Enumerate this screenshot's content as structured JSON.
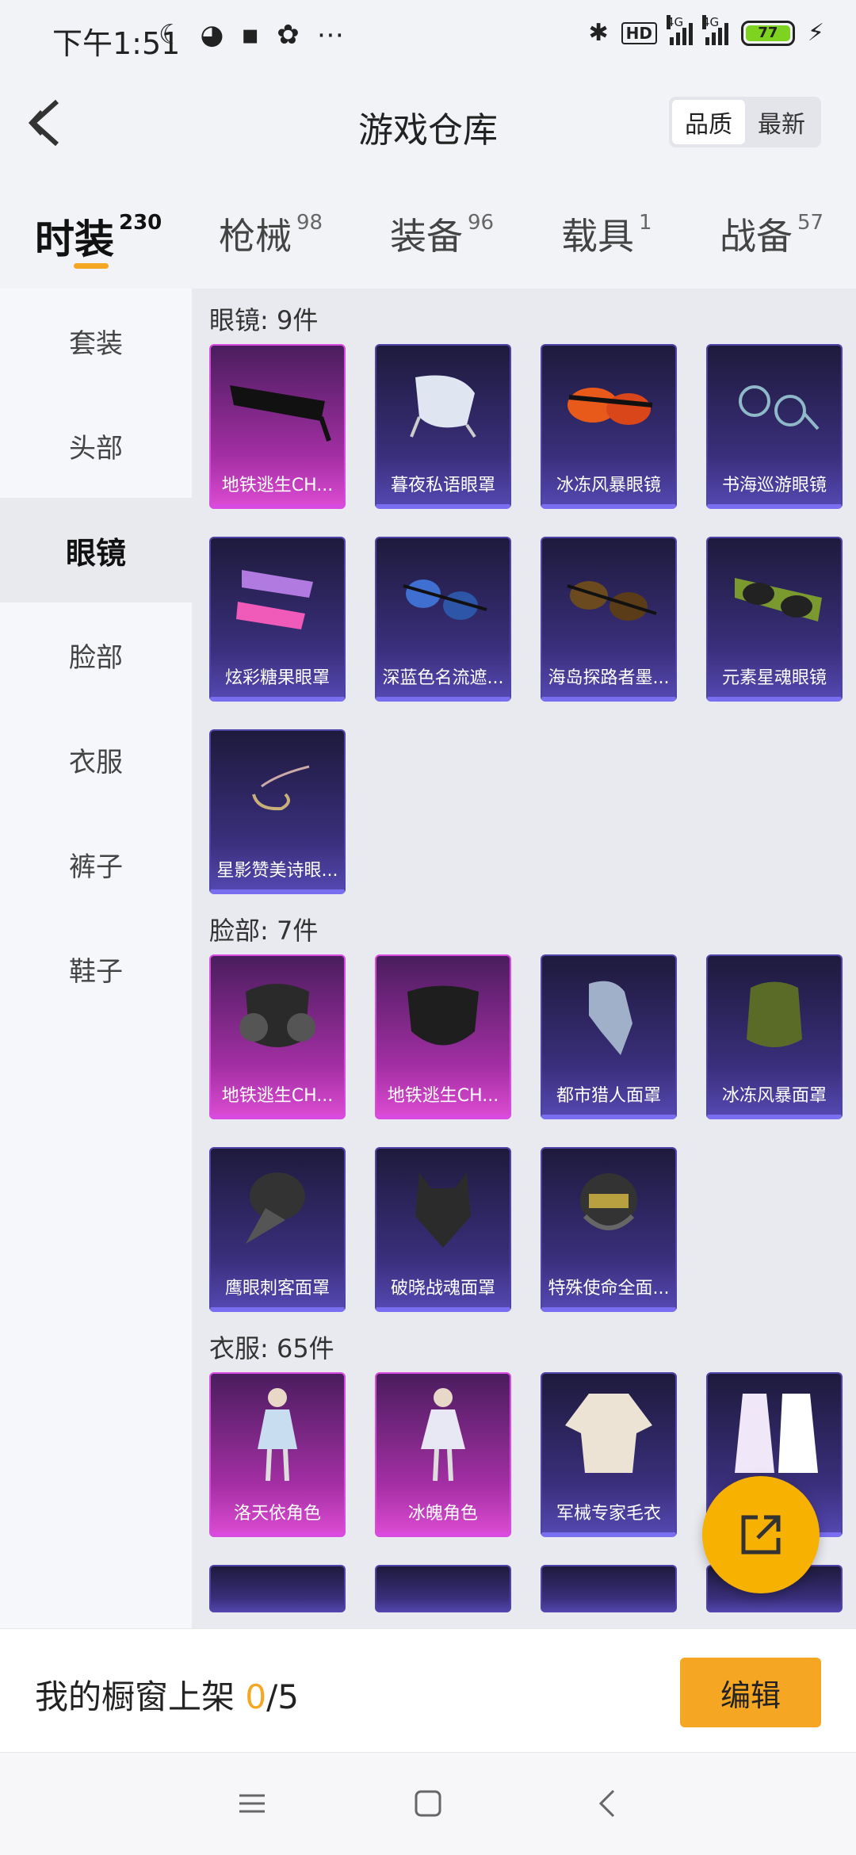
{
  "status": {
    "time": "下午1:51",
    "battery": "77",
    "net1": "4G",
    "net2": "4G",
    "hd": "HD"
  },
  "header": {
    "title": "游戏仓库",
    "toggle": [
      "品质",
      "最新"
    ],
    "toggle_active": 0
  },
  "tabs": [
    {
      "label": "时装",
      "count": "230",
      "active": true
    },
    {
      "label": "枪械",
      "count": "98"
    },
    {
      "label": "装备",
      "count": "96"
    },
    {
      "label": "载具",
      "count": "1"
    },
    {
      "label": "战备",
      "count": "57"
    }
  ],
  "sidebar": [
    {
      "label": "套装"
    },
    {
      "label": "头部"
    },
    {
      "label": "眼镜",
      "active": true
    },
    {
      "label": "脸部"
    },
    {
      "label": "衣服"
    },
    {
      "label": "裤子"
    },
    {
      "label": "鞋子"
    }
  ],
  "sections": [
    {
      "title": "眼镜: 9件",
      "items": [
        {
          "name": "地铁逃生CH...",
          "rarity": "pink",
          "icon": "black-sunglasses-icon"
        },
        {
          "name": "暮夜私语眼罩",
          "rarity": "purple",
          "icon": "white-eyemask-icon"
        },
        {
          "name": "冰冻风暴眼镜",
          "rarity": "purple",
          "icon": "orange-goggles-icon"
        },
        {
          "name": "书海巡游眼镜",
          "rarity": "purple",
          "icon": "round-glasses-icon"
        },
        {
          "name": "炫彩糖果眼罩",
          "rarity": "purple",
          "icon": "candy-eyemask-icon"
        },
        {
          "name": "深蓝色名流遮...",
          "rarity": "purple",
          "icon": "blue-sunglasses-icon"
        },
        {
          "name": "海岛探路者墨...",
          "rarity": "purple",
          "icon": "brown-sunglasses-icon"
        },
        {
          "name": "元素星魂眼镜",
          "rarity": "purple",
          "icon": "green-sunglasses-icon"
        },
        {
          "name": "星影赞美诗眼...",
          "rarity": "purple",
          "icon": "wire-eyepiece-icon"
        }
      ]
    },
    {
      "title": "脸部: 7件",
      "items": [
        {
          "name": "地铁逃生CH...",
          "rarity": "pink",
          "icon": "gas-mask-icon"
        },
        {
          "name": "地铁逃生CH...",
          "rarity": "pink",
          "icon": "face-mask-icon"
        },
        {
          "name": "都市猎人面罩",
          "rarity": "purple",
          "icon": "bandana-icon"
        },
        {
          "name": "冰冻风暴面罩",
          "rarity": "purple",
          "icon": "scarf-mask-icon"
        },
        {
          "name": "鹰眼刺客面罩",
          "rarity": "purple",
          "icon": "plague-mask-icon"
        },
        {
          "name": "破晓战魂面罩",
          "rarity": "purple",
          "icon": "wolf-mask-icon"
        },
        {
          "name": "特殊使命全面...",
          "rarity": "purple",
          "icon": "tactical-helmet-icon"
        }
      ]
    },
    {
      "title": "衣服: 65件",
      "items": [
        {
          "name": "洛天依角色",
          "rarity": "pink",
          "icon": "character-outfit-icon"
        },
        {
          "name": "冰魄角色",
          "rarity": "pink",
          "icon": "character-outfit-icon"
        },
        {
          "name": "军械专家毛衣",
          "rarity": "purple",
          "icon": "sweater-icon"
        },
        {
          "name": "",
          "rarity": "purple",
          "icon": "dress-outfit-icon"
        }
      ]
    }
  ],
  "bottom": {
    "prefix": "我的橱窗上架 ",
    "count": "0",
    "total": "/5",
    "edit_label": "编辑"
  }
}
